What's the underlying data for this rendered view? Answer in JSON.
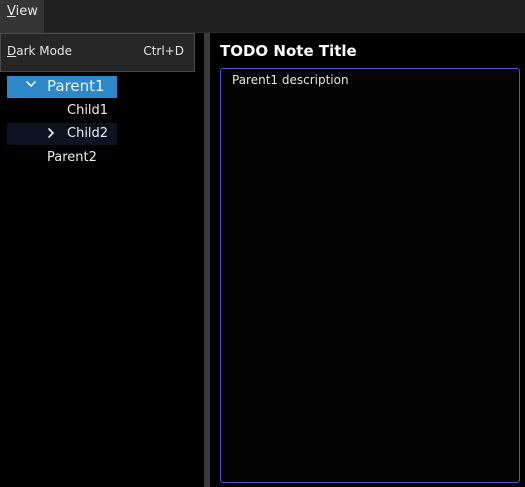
{
  "menubar": {
    "view": {
      "mnemonic": "V",
      "rest": "iew"
    }
  },
  "view_menu": {
    "dark_mode": {
      "mnemonic": "D",
      "rest": "ark Mode",
      "shortcut": "Ctrl+D"
    }
  },
  "tree": {
    "items": [
      {
        "label": "Parent1",
        "expanded": true,
        "selected": true
      },
      {
        "label": "Child1"
      },
      {
        "label": "Child2",
        "expanded": false
      },
      {
        "label": "Parent2"
      }
    ]
  },
  "note": {
    "title": "TODO Note Title",
    "description": "Parent1 description"
  },
  "colors": {
    "selection": "#2e87c9",
    "focus_border": "#3f57d9"
  }
}
